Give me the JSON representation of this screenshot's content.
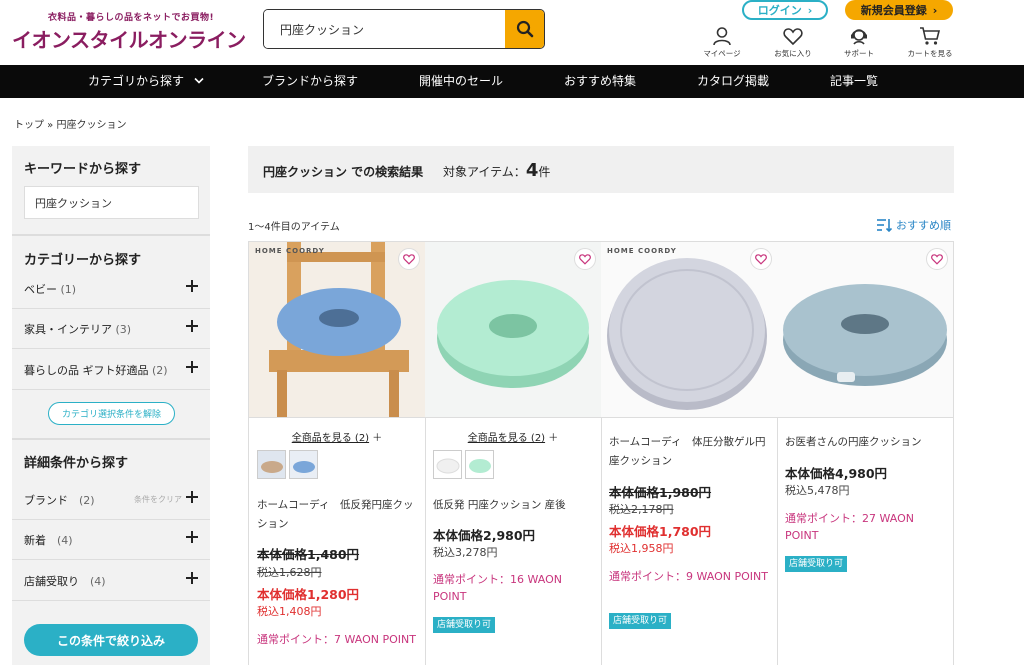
{
  "header": {
    "logo_tagline": "衣料品・暮らしの品をネットでお買物!",
    "logo_name": "イオンスタイルオンライン",
    "search_value": "円座クッション",
    "login_label": "ログイン",
    "register_label": "新規会員登録",
    "icons": [
      {
        "name": "user-icon",
        "label": "マイページ"
      },
      {
        "name": "heart-icon",
        "label": "お気に入り"
      },
      {
        "name": "support-icon",
        "label": "サポート"
      },
      {
        "name": "cart-icon",
        "label": "カートを見る"
      }
    ]
  },
  "nav": [
    "カテゴリから探す",
    "ブランドから探す",
    "開催中のセール",
    "おすすめ特集",
    "カタログ掲載",
    "記事一覧"
  ],
  "breadcrumb": "トップ » 円座クッション",
  "sidebar": {
    "keyword_heading": "キーワードから探す",
    "keyword_value": "円座クッション",
    "category_heading": "カテゴリーから探す",
    "categories": [
      {
        "label": "ベビー",
        "count": "(1)"
      },
      {
        "label": "家具・インテリア",
        "count": "(3)"
      },
      {
        "label": "暮らしの品 ギフト好適品",
        "count": "(2)"
      }
    ],
    "clear_category_label": "カテゴリ選択条件を解除",
    "detail_heading": "詳細条件から探す",
    "details": [
      {
        "label": "ブランド",
        "count": "(2)",
        "clear": "条件をクリア"
      },
      {
        "label": "新着",
        "count": "(4)",
        "clear": ""
      },
      {
        "label": "店舗受取り",
        "count": "(4)",
        "clear": ""
      }
    ],
    "narrow_button": "この条件で絞り込み"
  },
  "results": {
    "title": "円座クッション での検索結果",
    "count_label": "対象アイテム：",
    "count": "4",
    "count_unit": "件",
    "range": "1〜4件目のアイテム",
    "sort_label": "おすすめ順"
  },
  "products": [
    {
      "brand_mark": "HOME COORDY",
      "see_all": "全商品を見る (2)",
      "name": "ホームコーディ　低反発円座クッション",
      "old_price": "本体価格1,480円",
      "old_tax": "税込1,628円",
      "price": "本体価格1,280円",
      "tax": "税込1,408円",
      "points": "通常ポイント：7 WAON POINT",
      "store_pickup": "",
      "color": "#7aa6d9"
    },
    {
      "brand_mark": "",
      "see_all": "全商品を見る (2)",
      "name": "低反発 円座クッション 産後",
      "old_price": "",
      "old_tax": "",
      "price": "本体価格2,980円",
      "tax": "税込3,278円",
      "points": "通常ポイント：16 WAON POINT",
      "store_pickup": "店舗受取り可",
      "color": "#a8e6c9"
    },
    {
      "brand_mark": "HOME COORDY",
      "see_all": "",
      "name": "ホームコーディ　体圧分散ゲル円座クッション",
      "old_price": "本体価格1,980円",
      "old_tax": "税込2,178円",
      "price": "本体価格1,780円",
      "tax": "税込1,958円",
      "points": "通常ポイント：9 WAON POINT",
      "store_pickup": "店舗受取り可",
      "color": "#c9cbd6"
    },
    {
      "brand_mark": "",
      "see_all": "",
      "name": "お医者さんの円座クッション",
      "old_price": "",
      "old_tax": "",
      "price": "本体価格4,980円",
      "tax": "税込5,478円",
      "points": "通常ポイント：27 WAON POINT",
      "store_pickup": "店舗受取り可",
      "color": "#a7c0cc"
    }
  ]
}
